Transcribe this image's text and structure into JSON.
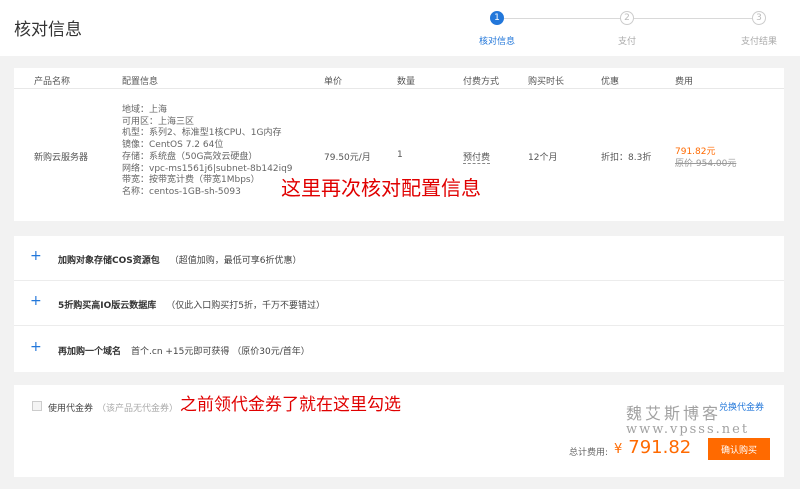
{
  "header": {
    "title": "核对信息",
    "steps": [
      {
        "num": "1",
        "label": "核对信息",
        "state": "active"
      },
      {
        "num": "2",
        "label": "支付",
        "state": "todo"
      },
      {
        "num": "3",
        "label": "支付结果",
        "state": "todo"
      }
    ]
  },
  "order": {
    "columns": [
      "产品名称",
      "配置信息",
      "单价",
      "数量",
      "付费方式",
      "购买时长",
      "优惠",
      "费用"
    ],
    "product_name": "新购云服务器",
    "config": [
      "地域：上海",
      "可用区：上海三区",
      "机型：系列2、标准型1核CPU、1G内存",
      "镜像：CentOS 7.2 64位",
      "存储：系统盘（50G高效云硬盘）",
      "网络：vpc-ms1561j6|subnet-8b142iq9",
      "带宽：按带宽计费（带宽1Mbps）",
      "名称：centos-1GB-sh-5093"
    ],
    "unit_price": "79.50元/月",
    "quantity": "1",
    "pay_method": "预付费",
    "duration": "12个月",
    "discount": "折扣：8.3折",
    "fee": "791.82元",
    "original_fee": "原价 954.00元"
  },
  "annotations": {
    "config_note": "这里再次核对配置信息",
    "voucher_note": "之前领代金券了就在这里勾选"
  },
  "addons": [
    {
      "title": "加购对象存储COS资源包",
      "note": "（超值加购，最低可享6折优惠）"
    },
    {
      "title": "5折购买高IO版云数据库",
      "note": "（仅此入口购买打5折，千万不要错过）"
    },
    {
      "title": "再加购一个域名",
      "note": "首个.cn +15元即可获得  （原价30元/首年）"
    }
  ],
  "voucher": {
    "label": "使用代金券",
    "hint": "（该产品无代金券）",
    "exchange_link": "兑换代金券"
  },
  "total": {
    "label": "总计费用:",
    "currency": "¥",
    "amount": "791.82",
    "buy_label": "确认购买"
  },
  "watermark": {
    "line1": "魏艾斯博客",
    "line2": "www.vpsss.net"
  },
  "colors": {
    "accent": "#2277da",
    "price": "#ff6a00",
    "annotation": "#e00000"
  }
}
